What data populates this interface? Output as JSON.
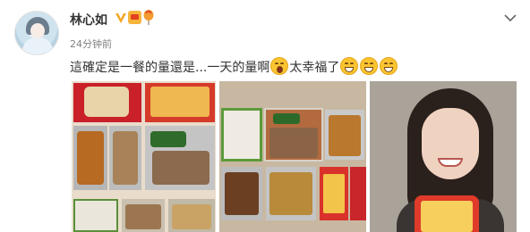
{
  "post": {
    "author": {
      "name": "林心如",
      "avatar_icon": "avatar"
    },
    "badges": [
      "verified-v-icon",
      "vip-crown-icon",
      "hot-balloon-icon"
    ],
    "timestamp": "24分钟前",
    "text_main": "這確定是一餐的量還是...一天的量啊",
    "text_after": "太幸福了",
    "emojis": [
      "shout-emoji-icon",
      "laugh-emoji-icon",
      "laugh-emoji-icon",
      "laugh-emoji-icon"
    ],
    "photos": [
      "bento-boxes-photo",
      "food-containers-photo",
      "selfie-photo"
    ]
  },
  "colors": {
    "accent": "#f6a623",
    "text": "#333333",
    "meta": "#808080"
  }
}
